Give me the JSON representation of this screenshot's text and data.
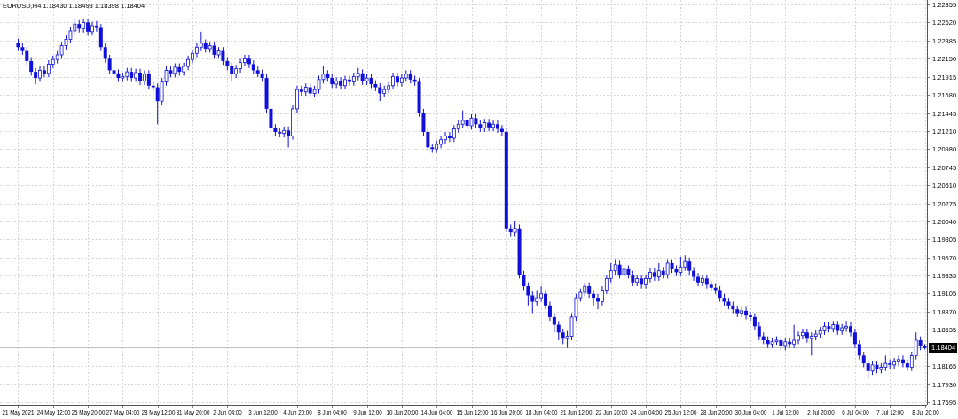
{
  "chart": {
    "chart_data": {
      "type": "candlestick",
      "title": "EURUSD,H4  1.18430 1.18493 1.18398 1.18404",
      "grid": true,
      "ylim": [
        1.17661,
        1.22912
      ],
      "yticks": [
        {
          "value": 1.22855,
          "label": "1.22855"
        },
        {
          "value": 1.2262,
          "label": "1.22620"
        },
        {
          "value": 1.22385,
          "label": "1.22385"
        },
        {
          "value": 1.2215,
          "label": "1.22150"
        },
        {
          "value": 1.21915,
          "label": "1.21915"
        },
        {
          "value": 1.2168,
          "label": "1.21680"
        },
        {
          "value": 1.21445,
          "label": "1.21445"
        },
        {
          "value": 1.2121,
          "label": "1.21210"
        },
        {
          "value": 1.2098,
          "label": "1.20980"
        },
        {
          "value": 1.20745,
          "label": "1.20745"
        },
        {
          "value": 1.2051,
          "label": "1.20510"
        },
        {
          "value": 1.20275,
          "label": "1.20275"
        },
        {
          "value": 1.2004,
          "label": "1.20040"
        },
        {
          "value": 1.19805,
          "label": "1.19805"
        },
        {
          "value": 1.1957,
          "label": "1.19570"
        },
        {
          "value": 1.19335,
          "label": "1.19335"
        },
        {
          "value": 1.19105,
          "label": "1.19105"
        },
        {
          "value": 1.1887,
          "label": "1.18870"
        },
        {
          "value": 1.18635,
          "label": "1.18635"
        },
        {
          "value": 1.18165,
          "label": "1.18165"
        },
        {
          "value": 1.1793,
          "label": "1.17930"
        },
        {
          "value": 1.17695,
          "label": "1.17695"
        }
      ],
      "categories": [
        "21 May 2021",
        null,
        null,
        null,
        null,
        null,
        null,
        null,
        "24 May 12:00",
        null,
        null,
        null,
        null,
        null,
        null,
        null,
        "25 May 20:00",
        null,
        null,
        null,
        null,
        null,
        null,
        null,
        "27 May 04:00",
        null,
        null,
        null,
        null,
        null,
        null,
        null,
        "28 May 12:00",
        null,
        null,
        null,
        null,
        null,
        null,
        null,
        "31 May 20:00",
        null,
        null,
        null,
        null,
        null,
        null,
        null,
        "2 Jun 04:00",
        null,
        null,
        null,
        null,
        null,
        null,
        null,
        "3 Jun 12:00",
        null,
        null,
        null,
        null,
        null,
        null,
        null,
        "4 Jun 20:00",
        null,
        null,
        null,
        null,
        null,
        null,
        null,
        "8 Jun 04:00",
        null,
        null,
        null,
        null,
        null,
        null,
        null,
        "9 Jun 12:00",
        null,
        null,
        null,
        null,
        null,
        null,
        null,
        "10 Jun 20:00",
        null,
        null,
        null,
        null,
        null,
        null,
        null,
        "14 Jun 04:00",
        null,
        null,
        null,
        null,
        null,
        null,
        null,
        "15 Jun 12:00",
        null,
        null,
        null,
        null,
        null,
        null,
        null,
        "16 Jun 20:00",
        null,
        null,
        null,
        null,
        null,
        null,
        null,
        "18 Jun 04:00",
        null,
        null,
        null,
        null,
        null,
        null,
        null,
        "21 Jun 12:00",
        null,
        null,
        null,
        null,
        null,
        null,
        null,
        "22 Jun 20:00",
        null,
        null,
        null,
        null,
        null,
        null,
        null,
        "24 Jun 04:00",
        null,
        null,
        null,
        null,
        null,
        null,
        null,
        "25 Jun 12:00",
        null,
        null,
        null,
        null,
        null,
        null,
        null,
        "28 Jun 20:00",
        null,
        null,
        null,
        null,
        null,
        null,
        null,
        "30 Jun 04:00",
        null,
        null,
        null,
        null,
        null,
        null,
        null,
        "1 Jul 12:00",
        null,
        null,
        null,
        null,
        null,
        null,
        null,
        "2 Jul 20:00",
        null,
        null,
        null,
        null,
        null,
        null,
        null,
        "6 Jul 04:00",
        null,
        null,
        null,
        null,
        null,
        null,
        null,
        "7 Jul 12:00",
        null,
        null,
        null,
        null,
        null,
        null,
        null,
        "8 Jul 20:00"
      ],
      "ohlc": [
        [
          1.2236,
          1.2241,
          1.2225,
          1.223
        ],
        [
          1.223,
          1.2235,
          1.222,
          1.2225
        ],
        [
          1.2225,
          1.223,
          1.2207,
          1.2212
        ],
        [
          1.2212,
          1.2217,
          1.2193,
          1.2198
        ],
        [
          1.2198,
          1.2203,
          1.2182,
          1.219
        ],
        [
          1.219,
          1.2205,
          1.2185,
          1.22
        ],
        [
          1.22,
          1.2205,
          1.2191,
          1.2196
        ],
        [
          1.2196,
          1.2213,
          1.2191,
          1.2208
        ],
        [
          1.2208,
          1.2219,
          1.2203,
          1.2214
        ],
        [
          1.2214,
          1.2225,
          1.2209,
          1.222
        ],
        [
          1.222,
          1.2237,
          1.2215,
          1.2232
        ],
        [
          1.2232,
          1.2245,
          1.2227,
          1.224
        ],
        [
          1.224,
          1.2256,
          1.2235,
          1.2251
        ],
        [
          1.2251,
          1.2266,
          1.2246,
          1.226
        ],
        [
          1.226,
          1.2265,
          1.2249,
          1.2254
        ],
        [
          1.2254,
          1.2267,
          1.2249,
          1.2262
        ],
        [
          1.2262,
          1.2267,
          1.2245,
          1.225
        ],
        [
          1.225,
          1.2263,
          1.2245,
          1.2258
        ],
        [
          1.2258,
          1.2264,
          1.225,
          1.2255
        ],
        [
          1.2255,
          1.226,
          1.2225,
          1.223
        ],
        [
          1.223,
          1.2235,
          1.221,
          1.2215
        ],
        [
          1.2215,
          1.222,
          1.2195,
          1.22
        ],
        [
          1.22,
          1.2205,
          1.2191,
          1.2196
        ],
        [
          1.2196,
          1.2201,
          1.2185,
          1.219
        ],
        [
          1.219,
          1.2197,
          1.2185,
          1.2192
        ],
        [
          1.2192,
          1.2203,
          1.2187,
          1.2198
        ],
        [
          1.2198,
          1.2203,
          1.2185,
          1.219
        ],
        [
          1.219,
          1.2202,
          1.2185,
          1.2197
        ],
        [
          1.2197,
          1.2202,
          1.2181,
          1.2186
        ],
        [
          1.2186,
          1.22,
          1.2181,
          1.2195
        ],
        [
          1.2195,
          1.22,
          1.2175,
          1.218
        ],
        [
          1.218,
          1.2185,
          1.2173,
          1.2178
        ],
        [
          1.2178,
          1.2183,
          1.213,
          1.216
        ],
        [
          1.216,
          1.219,
          1.2155,
          1.2185
        ],
        [
          1.2185,
          1.2205,
          1.218,
          1.22
        ],
        [
          1.22,
          1.2205,
          1.2191,
          1.2196
        ],
        [
          1.2196,
          1.2209,
          1.2191,
          1.2204
        ],
        [
          1.2204,
          1.2209,
          1.2193,
          1.2198
        ],
        [
          1.2198,
          1.221,
          1.2193,
          1.2205
        ],
        [
          1.2205,
          1.2219,
          1.22,
          1.2214
        ],
        [
          1.2214,
          1.2227,
          1.2209,
          1.2222
        ],
        [
          1.2222,
          1.2235,
          1.2217,
          1.223
        ],
        [
          1.223,
          1.225,
          1.2225,
          1.2235
        ],
        [
          1.2235,
          1.224,
          1.2223,
          1.2228
        ],
        [
          1.2228,
          1.2237,
          1.2223,
          1.2232
        ],
        [
          1.2232,
          1.2237,
          1.2215,
          1.222
        ],
        [
          1.222,
          1.223,
          1.2215,
          1.2225
        ],
        [
          1.2225,
          1.223,
          1.2207,
          1.2212
        ],
        [
          1.2212,
          1.2217,
          1.22,
          1.2205
        ],
        [
          1.2205,
          1.221,
          1.2185,
          1.2195
        ],
        [
          1.2195,
          1.2207,
          1.219,
          1.2202
        ],
        [
          1.2202,
          1.2215,
          1.2197,
          1.221
        ],
        [
          1.221,
          1.222,
          1.2205,
          1.2215
        ],
        [
          1.2215,
          1.222,
          1.2203,
          1.2208
        ],
        [
          1.2208,
          1.2213,
          1.2195,
          1.22
        ],
        [
          1.22,
          1.2205,
          1.2191,
          1.2196
        ],
        [
          1.2196,
          1.2201,
          1.2185,
          1.219
        ],
        [
          1.219,
          1.2195,
          1.2145,
          1.215
        ],
        [
          1.215,
          1.2155,
          1.212,
          1.2125
        ],
        [
          1.2125,
          1.213,
          1.2115,
          1.212
        ],
        [
          1.212,
          1.2125,
          1.2113,
          1.2118
        ],
        [
          1.2118,
          1.2127,
          1.2113,
          1.2122
        ],
        [
          1.2122,
          1.2127,
          1.21,
          1.2115
        ],
        [
          1.2115,
          1.2155,
          1.211,
          1.215
        ],
        [
          1.215,
          1.218,
          1.2145,
          1.2175
        ],
        [
          1.2175,
          1.218,
          1.2167,
          1.2172
        ],
        [
          1.2172,
          1.2183,
          1.2167,
          1.2178
        ],
        [
          1.2178,
          1.2183,
          1.2165,
          1.217
        ],
        [
          1.217,
          1.218,
          1.2165,
          1.2175
        ],
        [
          1.2175,
          1.2193,
          1.217,
          1.2188
        ],
        [
          1.2188,
          1.2205,
          1.2183,
          1.2195
        ],
        [
          1.2195,
          1.22,
          1.2185,
          1.219
        ],
        [
          1.219,
          1.2195,
          1.2177,
          1.2182
        ],
        [
          1.2182,
          1.2191,
          1.2177,
          1.2186
        ],
        [
          1.2186,
          1.2191,
          1.2175,
          1.218
        ],
        [
          1.218,
          1.2193,
          1.2175,
          1.2188
        ],
        [
          1.2188,
          1.2193,
          1.218,
          1.2185
        ],
        [
          1.2185,
          1.2197,
          1.218,
          1.2192
        ],
        [
          1.2192,
          1.2203,
          1.2187,
          1.2196
        ],
        [
          1.2196,
          1.2201,
          1.2181,
          1.2186
        ],
        [
          1.2186,
          1.2195,
          1.2181,
          1.219
        ],
        [
          1.219,
          1.2195,
          1.2177,
          1.2182
        ],
        [
          1.2182,
          1.2187,
          1.2173,
          1.2178
        ],
        [
          1.2178,
          1.2183,
          1.216,
          1.217
        ],
        [
          1.217,
          1.218,
          1.2165,
          1.2175
        ],
        [
          1.2175,
          1.2185,
          1.217,
          1.218
        ],
        [
          1.218,
          1.2197,
          1.2175,
          1.2192
        ],
        [
          1.2192,
          1.2197,
          1.2179,
          1.2184
        ],
        [
          1.2184,
          1.2195,
          1.2179,
          1.219
        ],
        [
          1.219,
          1.22,
          1.2185,
          1.2195
        ],
        [
          1.2195,
          1.22,
          1.2183,
          1.2188
        ],
        [
          1.2188,
          1.2193,
          1.218,
          1.2185
        ],
        [
          1.2185,
          1.219,
          1.214,
          1.2145
        ],
        [
          1.2145,
          1.215,
          1.2115,
          1.212
        ],
        [
          1.212,
          1.2125,
          1.2095,
          1.21
        ],
        [
          1.21,
          1.2105,
          1.2093,
          1.2098
        ],
        [
          1.2098,
          1.2109,
          1.2093,
          1.2104
        ],
        [
          1.2104,
          1.2115,
          1.2099,
          1.211
        ],
        [
          1.211,
          1.212,
          1.2105,
          1.2115
        ],
        [
          1.2115,
          1.212,
          1.2107,
          1.2112
        ],
        [
          1.2112,
          1.2129,
          1.2107,
          1.2124
        ],
        [
          1.2124,
          1.2135,
          1.2119,
          1.213
        ],
        [
          1.213,
          1.2148,
          1.2125,
          1.2135
        ],
        [
          1.2135,
          1.214,
          1.2123,
          1.2128
        ],
        [
          1.2128,
          1.2143,
          1.2123,
          1.2138
        ],
        [
          1.2138,
          1.2143,
          1.2125,
          1.213
        ],
        [
          1.213,
          1.2135,
          1.212,
          1.2125
        ],
        [
          1.2125,
          1.2137,
          1.212,
          1.2132
        ],
        [
          1.2132,
          1.2137,
          1.2121,
          1.2126
        ],
        [
          1.2126,
          1.2135,
          1.2121,
          1.213
        ],
        [
          1.213,
          1.2135,
          1.2119,
          1.2124
        ],
        [
          1.2124,
          1.2129,
          1.2115,
          1.212
        ],
        [
          1.212,
          1.2125,
          1.199,
          1.1995
        ],
        [
          1.1995,
          1.2,
          1.1985,
          1.199
        ],
        [
          1.199,
          1.2005,
          1.1985,
          1.1995
        ],
        [
          1.1995,
          1.2,
          1.193,
          1.1935
        ],
        [
          1.1935,
          1.194,
          1.1915,
          1.192
        ],
        [
          1.192,
          1.1925,
          1.1895,
          1.1908
        ],
        [
          1.1908,
          1.1913,
          1.1885,
          1.19
        ],
        [
          1.19,
          1.1915,
          1.1895,
          1.1905
        ],
        [
          1.1905,
          1.192,
          1.19,
          1.191
        ],
        [
          1.191,
          1.1915,
          1.189,
          1.1895
        ],
        [
          1.1895,
          1.19,
          1.1875,
          1.188
        ],
        [
          1.188,
          1.1885,
          1.186,
          1.187
        ],
        [
          1.187,
          1.1875,
          1.185,
          1.186
        ],
        [
          1.186,
          1.1865,
          1.1845,
          1.1852
        ],
        [
          1.1852,
          1.1862,
          1.184,
          1.1855
        ],
        [
          1.1855,
          1.1885,
          1.185,
          1.188
        ],
        [
          1.188,
          1.191,
          1.1875,
          1.1905
        ],
        [
          1.1905,
          1.1917,
          1.19,
          1.1912
        ],
        [
          1.1912,
          1.1925,
          1.1907,
          1.192
        ],
        [
          1.192,
          1.1925,
          1.1905,
          1.191
        ],
        [
          1.191,
          1.1915,
          1.1895,
          1.1905
        ],
        [
          1.1905,
          1.191,
          1.189,
          1.19
        ],
        [
          1.19,
          1.192,
          1.1895,
          1.1915
        ],
        [
          1.1915,
          1.1935,
          1.191,
          1.193
        ],
        [
          1.193,
          1.195,
          1.1925,
          1.194
        ],
        [
          1.194,
          1.1955,
          1.1935,
          1.1948
        ],
        [
          1.1948,
          1.1953,
          1.193,
          1.1935
        ],
        [
          1.1935,
          1.195,
          1.193,
          1.1942
        ],
        [
          1.1942,
          1.1947,
          1.193,
          1.1935
        ],
        [
          1.1935,
          1.194,
          1.192,
          1.1925
        ],
        [
          1.1925,
          1.1935,
          1.192,
          1.193
        ],
        [
          1.193,
          1.1935,
          1.1917,
          1.1922
        ],
        [
          1.1922,
          1.1935,
          1.1917,
          1.193
        ],
        [
          1.193,
          1.1943,
          1.1925,
          1.1938
        ],
        [
          1.1938,
          1.1943,
          1.1927,
          1.1932
        ],
        [
          1.1932,
          1.195,
          1.1927,
          1.194
        ],
        [
          1.194,
          1.1945,
          1.193,
          1.1935
        ],
        [
          1.1935,
          1.1955,
          1.193,
          1.195
        ],
        [
          1.195,
          1.1955,
          1.1937,
          1.1942
        ],
        [
          1.1942,
          1.1947,
          1.1933,
          1.1938
        ],
        [
          1.1938,
          1.1958,
          1.1933,
          1.1945
        ],
        [
          1.1945,
          1.196,
          1.194,
          1.1952
        ],
        [
          1.1952,
          1.1957,
          1.1935,
          1.194
        ],
        [
          1.194,
          1.1945,
          1.1927,
          1.1932
        ],
        [
          1.1932,
          1.1937,
          1.192,
          1.1925
        ],
        [
          1.1925,
          1.1935,
          1.192,
          1.193
        ],
        [
          1.193,
          1.1935,
          1.1917,
          1.1922
        ],
        [
          1.1922,
          1.1927,
          1.1913,
          1.1918
        ],
        [
          1.1918,
          1.1923,
          1.191,
          1.1915
        ],
        [
          1.1915,
          1.192,
          1.19,
          1.1905
        ],
        [
          1.1905,
          1.191,
          1.1895,
          1.19
        ],
        [
          1.19,
          1.1905,
          1.189,
          1.1895
        ],
        [
          1.1895,
          1.19,
          1.1885,
          1.189
        ],
        [
          1.189,
          1.1895,
          1.188,
          1.1885
        ],
        [
          1.1885,
          1.1893,
          1.188,
          1.1888
        ],
        [
          1.1888,
          1.1893,
          1.1877,
          1.1882
        ],
        [
          1.1882,
          1.1887,
          1.1875,
          1.188
        ],
        [
          1.188,
          1.1885,
          1.1863,
          1.1868
        ],
        [
          1.1868,
          1.1873,
          1.185,
          1.1855
        ],
        [
          1.1855,
          1.186,
          1.1845,
          1.185
        ],
        [
          1.185,
          1.1855,
          1.184,
          1.1845
        ],
        [
          1.1845,
          1.1853,
          1.184,
          1.1848
        ],
        [
          1.1848,
          1.1855,
          1.1843,
          1.185
        ],
        [
          1.185,
          1.1855,
          1.1837,
          1.1842
        ],
        [
          1.1842,
          1.1853,
          1.1837,
          1.1848
        ],
        [
          1.1848,
          1.1853,
          1.184,
          1.1845
        ],
        [
          1.1845,
          1.187,
          1.184,
          1.185
        ],
        [
          1.185,
          1.1861,
          1.1845,
          1.1856
        ],
        [
          1.1856,
          1.1865,
          1.1851,
          1.186
        ],
        [
          1.186,
          1.1865,
          1.1847,
          1.1852
        ],
        [
          1.1852,
          1.186,
          1.183,
          1.1855
        ],
        [
          1.1855,
          1.1863,
          1.185,
          1.1858
        ],
        [
          1.1858,
          1.1867,
          1.1853,
          1.1862
        ],
        [
          1.1862,
          1.1873,
          1.1857,
          1.1868
        ],
        [
          1.1868,
          1.1873,
          1.186,
          1.1865
        ],
        [
          1.1865,
          1.1875,
          1.186,
          1.187
        ],
        [
          1.187,
          1.1875,
          1.1857,
          1.1862
        ],
        [
          1.1862,
          1.1871,
          1.1857,
          1.1866
        ],
        [
          1.1866,
          1.1875,
          1.1861,
          1.1868
        ],
        [
          1.1868,
          1.1873,
          1.1855,
          1.186
        ],
        [
          1.186,
          1.1865,
          1.184,
          1.1845
        ],
        [
          1.1845,
          1.185,
          1.1825,
          1.183
        ],
        [
          1.183,
          1.1835,
          1.1815,
          1.182
        ],
        [
          1.182,
          1.1825,
          1.18,
          1.181
        ],
        [
          1.181,
          1.1823,
          1.1805,
          1.1818
        ],
        [
          1.1818,
          1.1823,
          1.1807,
          1.1812
        ],
        [
          1.1812,
          1.182,
          1.1807,
          1.1815
        ],
        [
          1.1815,
          1.183,
          1.181,
          1.182
        ],
        [
          1.182,
          1.1825,
          1.1813,
          1.1818
        ],
        [
          1.1818,
          1.1827,
          1.1813,
          1.1822
        ],
        [
          1.1822,
          1.183,
          1.1817,
          1.1825
        ],
        [
          1.1825,
          1.183,
          1.1815,
          1.182
        ],
        [
          1.182,
          1.1825,
          1.181,
          1.1815
        ],
        [
          1.1815,
          1.1835,
          1.181,
          1.183
        ],
        [
          1.183,
          1.186,
          1.1825,
          1.185
        ],
        [
          1.185,
          1.1855,
          1.1837,
          1.1842
        ],
        [
          1.1842,
          1.1845,
          1.1838,
          1.184
        ]
      ],
      "ref_lines": [
        {
          "axis": "y",
          "value": 1.18404,
          "label": "1.18404"
        }
      ]
    }
  }
}
